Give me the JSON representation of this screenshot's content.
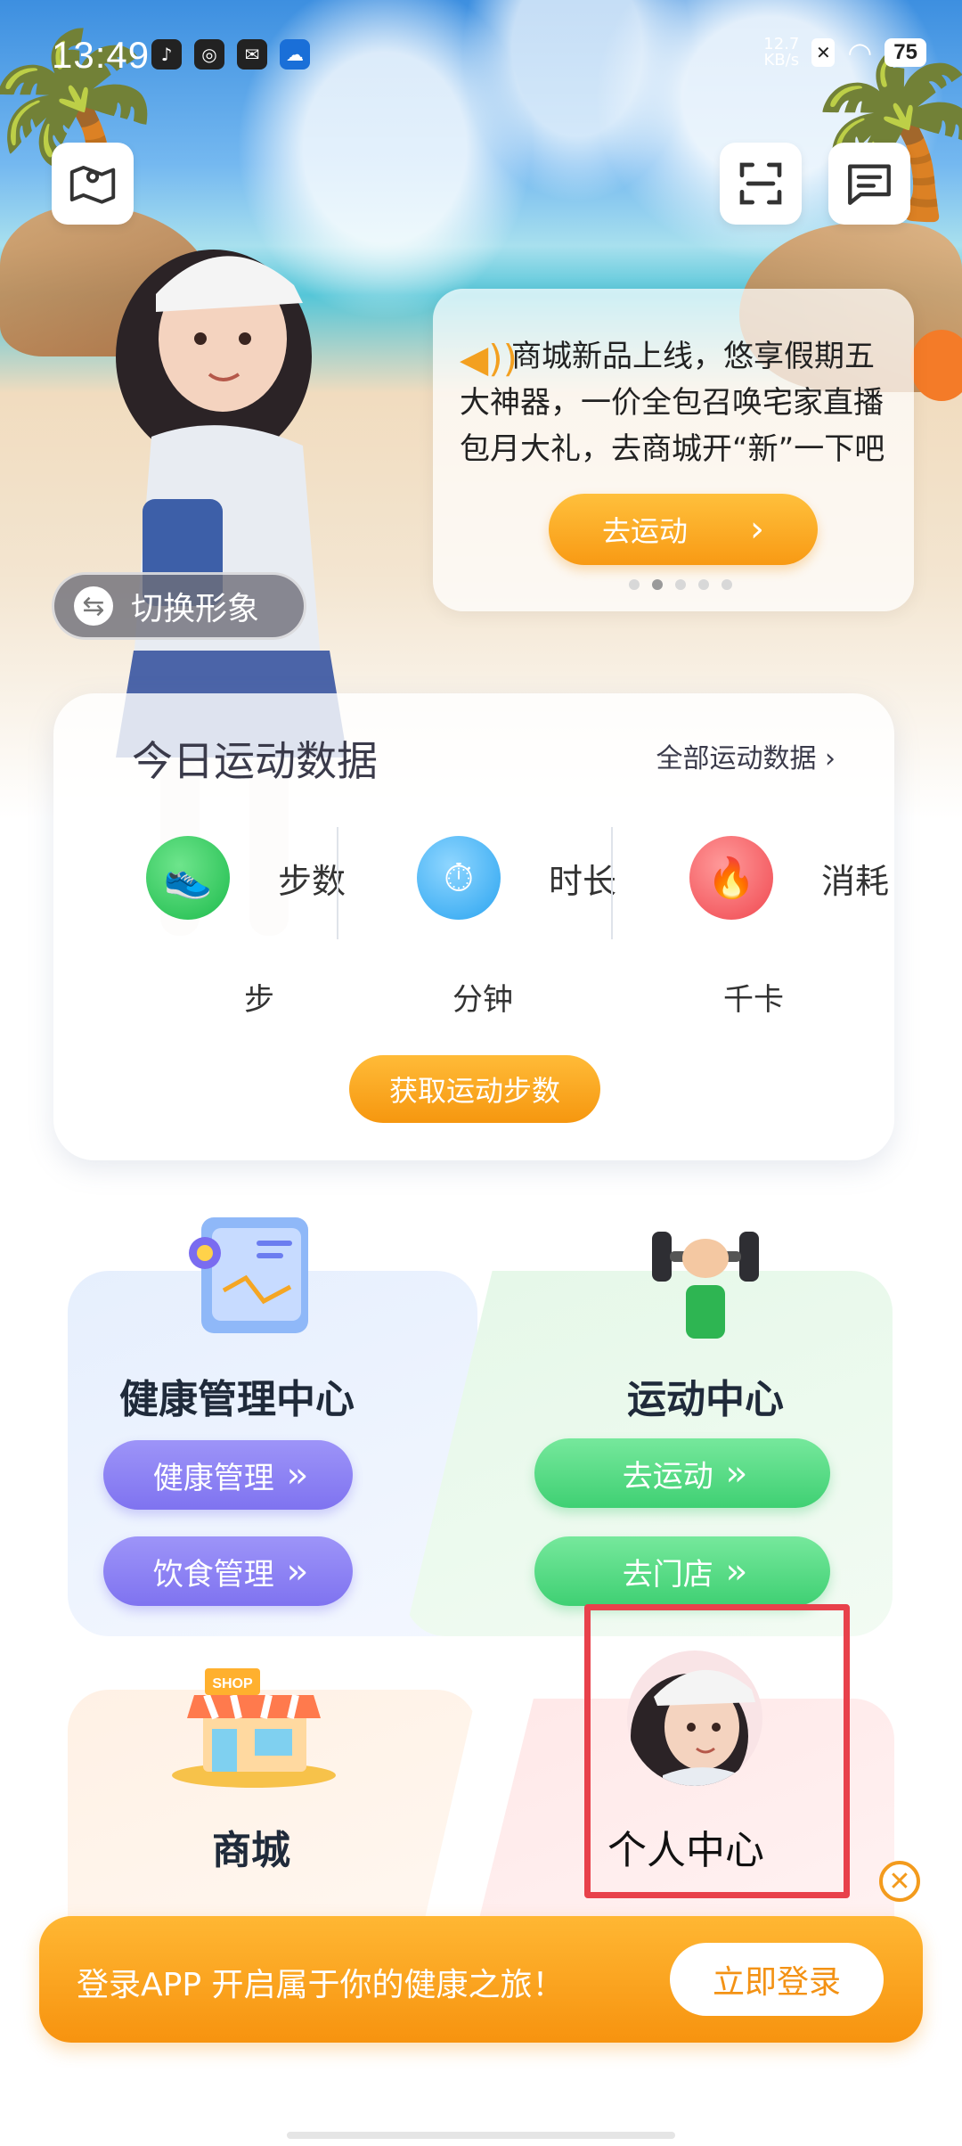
{
  "status_bar": {
    "time": "13:49",
    "net_speed_value": "12.7",
    "net_speed_unit": "KB/s",
    "battery": "75"
  },
  "notice": {
    "text": "商城新品上线，悠享假期五大神器，一价全包召唤宅家直播包月大礼，去商城开“新”一下吧",
    "button_label": "去运动"
  },
  "avatar_switch": {
    "label": "切换形象"
  },
  "today": {
    "title": "今日运动数据",
    "all_link": "全部运动数据 ›",
    "metrics": [
      {
        "label": "步数",
        "unit": "步"
      },
      {
        "label": "时长",
        "unit": "分钟"
      },
      {
        "label": "消耗",
        "unit": "千卡"
      }
    ],
    "fetch_button": "获取运动步数"
  },
  "sections": {
    "health": {
      "title": "健康管理中心",
      "buttons": [
        "健康管理",
        "饮食管理"
      ]
    },
    "sport": {
      "title": "运动中心",
      "buttons": [
        "去运动",
        "去门店"
      ]
    },
    "shop": {
      "title": "商城",
      "sign": "SHOP"
    },
    "me": {
      "title": "个人中心"
    }
  },
  "login_bar": {
    "message": "登录APP 开启属于你的健康之旅！",
    "button": "立即登录"
  },
  "colors": {
    "accent_orange": "#f7930f",
    "purple": "#7f73f0",
    "green": "#3fd073",
    "highlight_red": "#e8414b"
  }
}
